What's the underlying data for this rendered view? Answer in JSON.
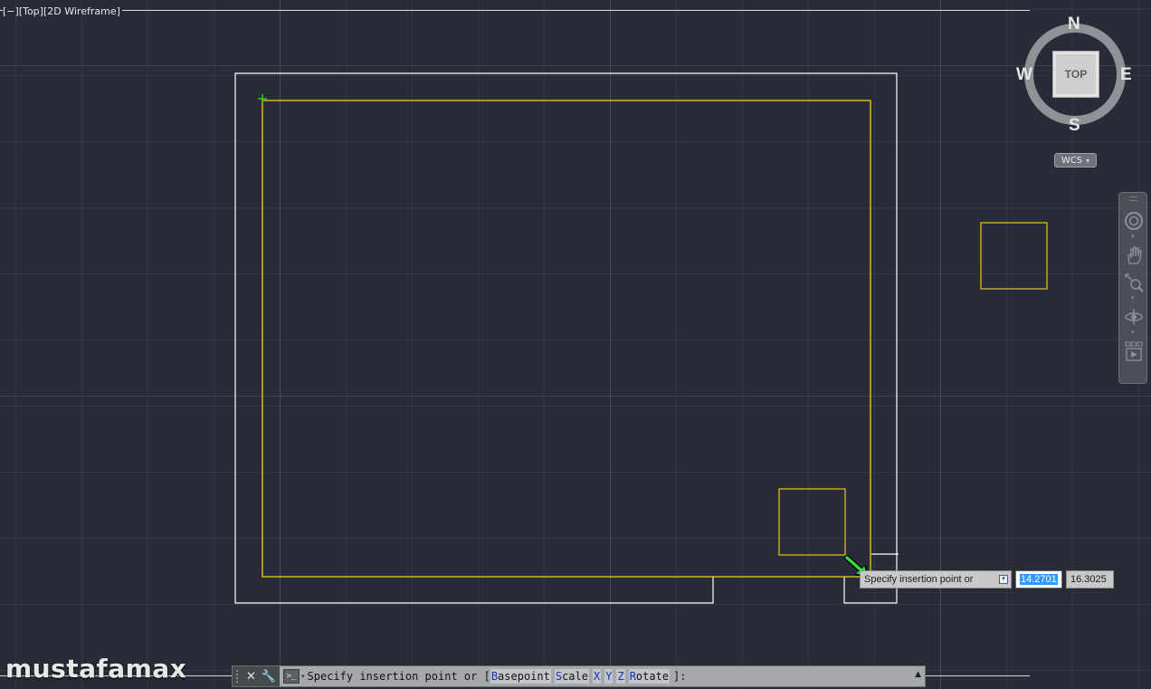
{
  "viewport": {
    "label_minus": "[−]",
    "label_view": "[Top]",
    "label_style": "[2D Wireframe]"
  },
  "viewcube": {
    "face": "TOP",
    "north": "N",
    "south": "S",
    "east": "E",
    "west": "W",
    "ucs_label": "WCS"
  },
  "navbar": {
    "tools": [
      "steering-wheel-icon",
      "pan-icon",
      "zoom-icon",
      "orbit-icon",
      "showmotion-icon"
    ]
  },
  "dynamic_input": {
    "prompt": "Specify insertion point or",
    "x_value": "14.2701",
    "y_value": "16.3025"
  },
  "command_line": {
    "prompt": "Specify insertion point or [",
    "options": [
      {
        "key": "B",
        "rest": "asepoint"
      },
      {
        "key": "S",
        "rest": "cale"
      },
      {
        "key": "X",
        "rest": ""
      },
      {
        "key": "Y",
        "rest": ""
      },
      {
        "key": "Z",
        "rest": ""
      },
      {
        "key": "R",
        "rest": "otate"
      }
    ],
    "suffix": "]:"
  },
  "watermark": "mustafamax",
  "colors": {
    "background": "#282c36",
    "outline_white": "#ffffff",
    "outline_yellow": "#e8c21a",
    "cursor_green": "#2ee03a"
  }
}
